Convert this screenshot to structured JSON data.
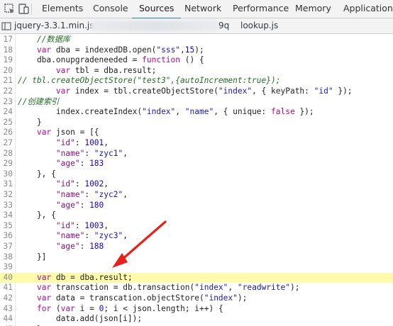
{
  "devtools_tabs": [
    "Elements",
    "Console",
    "Sources",
    "Network",
    "Performance",
    "Memory",
    "Application"
  ],
  "active_tab": "Sources",
  "file_tabs": {
    "first": "jquery-3.3.1.min.js",
    "second_suffix": "9q",
    "third": "lookup.js"
  },
  "code_lines": [
    {
      "n": "17",
      "html": "    <span class='c'>//数据库</span>"
    },
    {
      "n": "18",
      "html": "    <span class='k'>var</span> dba = indexedDB.open(<span class='s'>\"sss\"</span>,<span class='n'>15</span>);"
    },
    {
      "n": "19",
      "html": "    dba.onupgradeneeded = <span class='k'>function</span> () {"
    },
    {
      "n": "20",
      "html": "        <span class='k'>var</span> tbl = dba.result;"
    },
    {
      "n": "21",
      "html": "<span class='c'>// tbl.createObjectStore(\"test3\",{autoIncrement:true});</span>"
    },
    {
      "n": "22",
      "html": "        <span class='k'>var</span> index = tbl.createObjectStore(<span class='s'>\"index\"</span>, { keyPath: <span class='s'>\"id\"</span> });"
    },
    {
      "n": "23",
      "html": "<span class='c'>//创建索引</span>"
    },
    {
      "n": "24",
      "html": "        index.createIndex(<span class='s'>\"index\"</span>, <span class='s'>\"name\"</span>, { unique: <span class='k'>false</span> });"
    },
    {
      "n": "25",
      "html": "    }"
    },
    {
      "n": "26",
      "html": "    <span class='k'>var</span> json = [{"
    },
    {
      "n": "27",
      "html": "        <span class='p'>\"id\"</span>: <span class='n'>1001</span>,"
    },
    {
      "n": "28",
      "html": "        <span class='p'>\"name\"</span>: <span class='s'>\"zyc1\"</span>,"
    },
    {
      "n": "29",
      "html": "        <span class='p'>\"age\"</span>: <span class='n'>183</span>"
    },
    {
      "n": "30",
      "html": "    }, {"
    },
    {
      "n": "31",
      "html": "        <span class='p'>\"id\"</span>: <span class='n'>1002</span>,"
    },
    {
      "n": "32",
      "html": "        <span class='p'>\"name\"</span>: <span class='s'>\"zyc2\"</span>,"
    },
    {
      "n": "33",
      "html": "        <span class='p'>\"age\"</span>: <span class='n'>180</span>"
    },
    {
      "n": "34",
      "html": "    }, {"
    },
    {
      "n": "35",
      "html": "        <span class='p'>\"id\"</span>: <span class='n'>1003</span>,"
    },
    {
      "n": "36",
      "html": "        <span class='p'>\"name\"</span>: <span class='s'>\"zyc3\"</span>,"
    },
    {
      "n": "37",
      "html": "        <span class='p'>\"age\"</span>: <span class='n'>188</span>"
    },
    {
      "n": "38",
      "html": "    }]"
    },
    {
      "n": "39",
      "html": ""
    },
    {
      "n": "40",
      "html": "    <span class='k'>var</span> db = dba.result;",
      "highlight": true
    },
    {
      "n": "41",
      "html": "    <span class='k'>var</span> transcation = db.transaction(<span class='s'>\"index\"</span>, <span class='s'>\"readwrite\"</span>);"
    },
    {
      "n": "42",
      "html": "    <span class='k'>var</span> data = transcation.objectStore(<span class='s'>\"index\"</span>);"
    },
    {
      "n": "43",
      "html": "    <span class='k'>for</span> (<span class='k'>var</span> i = <span class='n'>0</span>; i &lt; json.length; i++) {"
    },
    {
      "n": "44",
      "html": "        data.add(json[i]);"
    },
    {
      "n": "45",
      "html": "    }"
    }
  ],
  "colors": {
    "highlight": "#fffbaa",
    "active_underline": "#1a73e8",
    "arrow": "#e8221b"
  },
  "icons": [
    "inspect-icon",
    "device-toggle-icon",
    "navigator-toggle-icon"
  ]
}
